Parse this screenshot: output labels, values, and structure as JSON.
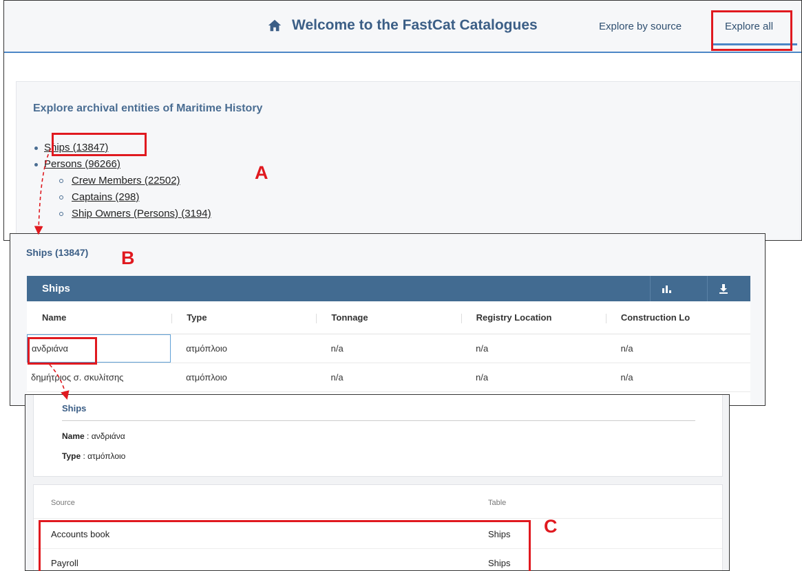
{
  "header": {
    "title": "Welcome to the FastCat Catalogues",
    "nav_explore_source": "Explore by source",
    "nav_explore_all": "Explore all"
  },
  "explore": {
    "heading": "Explore archival entities of Maritime History",
    "items": [
      {
        "label": "Ships (13847)"
      },
      {
        "label": "Persons (96266)"
      }
    ],
    "subitems": [
      {
        "label": "Crew Members (22502)"
      },
      {
        "label": "Captains (298)"
      },
      {
        "label": "Ship Owners (Persons) (3194)"
      }
    ]
  },
  "ships_view": {
    "section_title": "Ships (13847)",
    "grid_title": "Ships",
    "toolbar": {
      "chart_icon": "bar-chart-icon",
      "download_icon": "download-icon"
    },
    "columns": [
      "Name",
      "Type",
      "Tonnage",
      "Registry Location",
      "Construction Lo"
    ],
    "rows": [
      [
        "ανδριάνα",
        "ατμόπλοιο",
        "n/a",
        "n/a",
        "n/a"
      ],
      [
        "δημήτριος σ. σκυλίτσης",
        "ατμόπλοιο",
        "n/a",
        "n/a",
        "n/a"
      ]
    ]
  },
  "detail": {
    "title": "Ships",
    "name_label": "Name",
    "name_value": ": ανδριάνα",
    "type_label": "Type",
    "type_value": ": ατμόπλοιο",
    "sources_header": "Source",
    "table_header": "Table",
    "sources": [
      {
        "source": "Accounts book",
        "table": "Ships"
      },
      {
        "source": "Payroll",
        "table": "Ships"
      }
    ]
  },
  "annotations": {
    "label_a": "A",
    "label_b": "B",
    "label_c": "C",
    "color": "#e0191f"
  }
}
